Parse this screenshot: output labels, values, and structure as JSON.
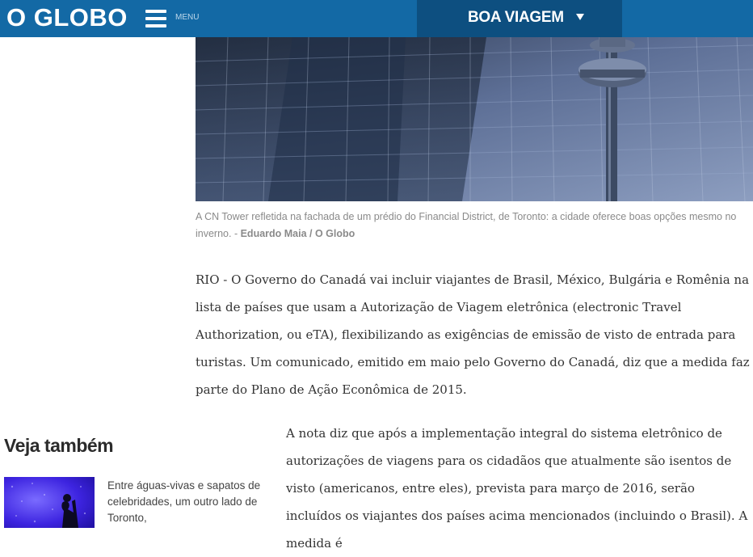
{
  "header": {
    "logo": "O GLOBO",
    "menu_label": "MENU",
    "section": "BOA VIAGEM",
    "colors": {
      "bar": "#1369a5",
      "section_bg": "#0d4f80"
    }
  },
  "photo": {
    "icon": "cn-tower-reflection-photo",
    "caption_text": "A CN Tower refletida na fachada de um prédio do Financial District, de Toronto: a cidade oferece boas opções mesmo no inverno. - ",
    "caption_credit": "Eduardo Maia / O Globo"
  },
  "article": {
    "paragraph_1": "RIO - O Governo do Canadá vai incluir viajantes de Brasil, México, Bulgária e Romênia na lista de países que usam a Autorização de Viagem eletrônica (electronic Travel Authorization, ou eTA), flexibilizando as exigências de emissão de visto de entrada para turistas. Um comunicado, emitido em maio pelo Governo do Canadá, diz que a medida faz parte do Plano de Ação Econômica de 2015.",
    "paragraph_2": "A nota diz que após a implementação integral do sistema eletrônico de autorizações de viagens para os cidadãos que atualmente são isentos de visto (americanos, entre eles), prevista para março de 2016, serão incluídos os viajantes dos países acima mencionados (incluindo o Brasil). A medida é"
  },
  "related": {
    "title": "Veja também",
    "items": [
      {
        "text": "Entre águas-vivas e sapatos de celebridades, um outro lado de Toronto,",
        "icon": "jellyfish-aquarium-thumbnail"
      }
    ]
  }
}
